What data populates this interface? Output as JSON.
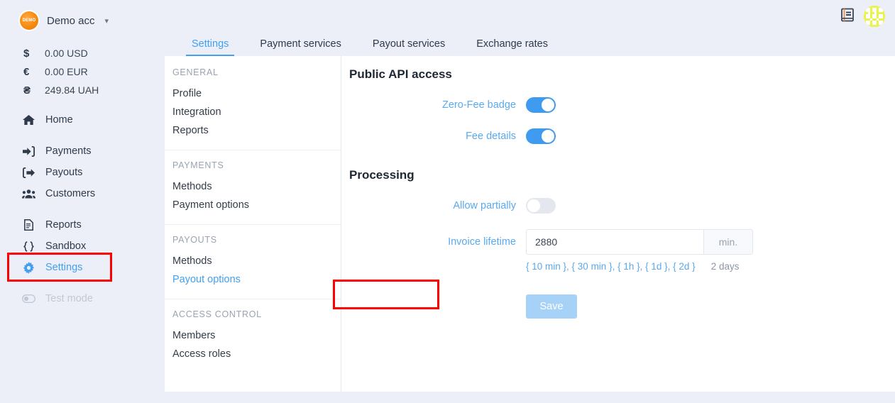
{
  "account": {
    "logo_text": "DEMO",
    "name": "Demo acc",
    "caret_icon": "chevron-down-icon"
  },
  "balances": [
    {
      "symbol": "$",
      "amount": "0.00 USD"
    },
    {
      "symbol": "€",
      "amount": "0.00 EUR"
    },
    {
      "symbol": "₴",
      "amount": "249.84 UAH"
    }
  ],
  "sidebar": {
    "groups": [
      {
        "items": [
          {
            "label": "Home",
            "icon": "home-icon"
          }
        ]
      },
      {
        "items": [
          {
            "label": "Payments",
            "icon": "sign-in-arrow-icon"
          },
          {
            "label": "Payouts",
            "icon": "sign-out-arrow-icon"
          },
          {
            "label": "Customers",
            "icon": "users-icon"
          }
        ]
      },
      {
        "items": [
          {
            "label": "Reports",
            "icon": "document-icon"
          },
          {
            "label": "Sandbox",
            "icon": "code-braces-icon"
          },
          {
            "label": "Settings",
            "icon": "gear-icon"
          }
        ]
      },
      {
        "items": [
          {
            "label": "Test mode",
            "icon": "toggle-icon"
          }
        ]
      }
    ]
  },
  "topbar": {
    "docs_icon": "book-icon",
    "avatar": "user-avatar"
  },
  "tabs": [
    {
      "label": "Settings"
    },
    {
      "label": "Payment services"
    },
    {
      "label": "Payout services"
    },
    {
      "label": "Exchange rates"
    }
  ],
  "submenu": [
    {
      "header": "GENERAL",
      "items": [
        "Profile",
        "Integration",
        "Reports"
      ]
    },
    {
      "header": "PAYMENTS",
      "items": [
        "Methods",
        "Payment options"
      ]
    },
    {
      "header": "PAYOUTS",
      "items": [
        "Methods",
        "Payout options"
      ]
    },
    {
      "header": "ACCESS CONTROL",
      "items": [
        "Members",
        "Access roles"
      ]
    }
  ],
  "main": {
    "api_section": {
      "title": "Public API access",
      "fields": [
        {
          "label": "Zero-Fee badge",
          "state": "on"
        },
        {
          "label": "Fee details",
          "state": "on"
        }
      ]
    },
    "processing_section": {
      "title": "Processing",
      "allow_partially": {
        "label": "Allow partially",
        "state": "off"
      },
      "invoice_lifetime": {
        "label": "Invoice lifetime",
        "value": "2880",
        "placeholder": "2880",
        "unit": "min.",
        "presets": "{ 10 min }, { 30 min }, { 1h }, { 1d }, { 2d }",
        "note": "2 days"
      },
      "save_label": "Save"
    }
  },
  "colors": {
    "accent": "#43a0f0",
    "toggle_on": "#3e9bf0",
    "toggle_off": "#e4e7ed",
    "sidebar_bg": "#eceff7",
    "panel_bg": "#ffffff",
    "annotation": "#ff0000",
    "save_button": "#a6d2f7",
    "avatar": "#e8f25a"
  }
}
